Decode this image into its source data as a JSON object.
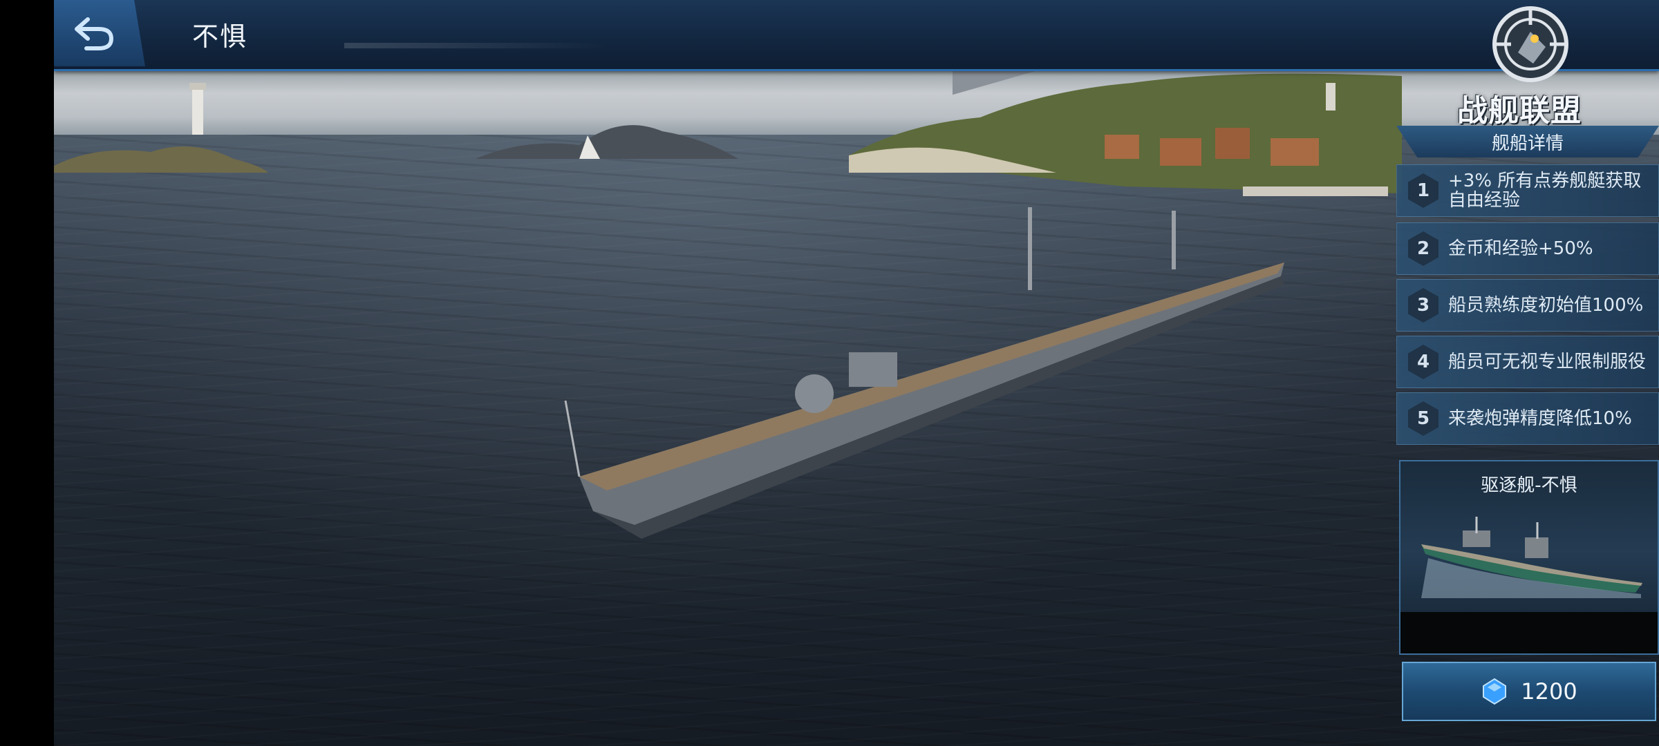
{
  "header": {
    "title": "不惧"
  },
  "logo": {
    "text": "战舰联盟"
  },
  "ship_details": {
    "title": "舰船详情",
    "items": [
      {
        "number": "1",
        "text_line1": "+3% 所有点券舰艇获取",
        "text_line2": "自由经验"
      },
      {
        "number": "2",
        "text_line1": "金币和经验+50%",
        "text_line2": ""
      },
      {
        "number": "3",
        "text_line1": "船员熟练度初始值100%",
        "text_line2": ""
      },
      {
        "number": "4",
        "text_line1": "船员可无视专业限制服役",
        "text_line2": ""
      },
      {
        "number": "5",
        "text_line1": "来袭炮弹精度降低10%",
        "text_line2": ""
      }
    ]
  },
  "ship_card": {
    "title": "驱逐舰-不惧"
  },
  "purchase": {
    "price": "1200",
    "currency_icon": "gem-icon"
  },
  "colors": {
    "header": "#12263f",
    "accent": "#2d6fb0",
    "panel": "#2c5070"
  }
}
